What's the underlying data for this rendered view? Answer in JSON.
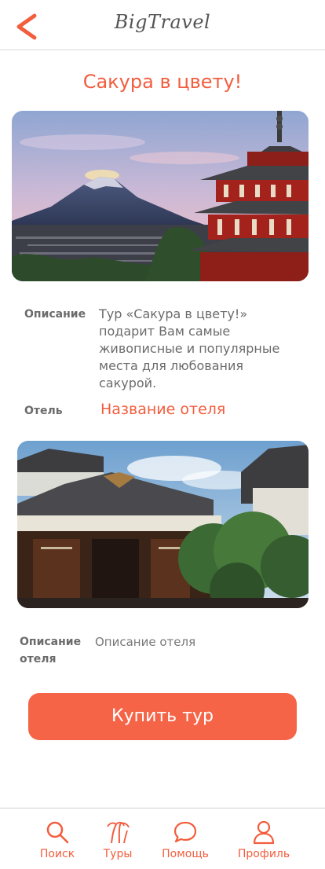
{
  "header": {
    "logo": "BigTravel",
    "back_icon": "chevron-left-icon"
  },
  "tour": {
    "title": "Сакура в цвету!",
    "description_label": "Описание",
    "description": "Тур «Сакура в цвету!» подарит Вам самые живописные и популярные места для любования сакурой.",
    "hotel_label": "Отель",
    "hotel_name": "Название отеля",
    "hotel_description_label": "Описание отеля",
    "hotel_description": "Описание отеля"
  },
  "buy_button": "Купить тур",
  "tabbar": [
    {
      "label": "Поиск",
      "icon": "search-icon"
    },
    {
      "label": "Туры",
      "icon": "palm-tree-icon"
    },
    {
      "label": "Помощь",
      "icon": "chat-bubble-icon"
    },
    {
      "label": "Профиль",
      "icon": "user-icon"
    }
  ],
  "colors": {
    "accent": "#f25d3d",
    "button": "#f56447",
    "text": "#6b6b6b"
  }
}
